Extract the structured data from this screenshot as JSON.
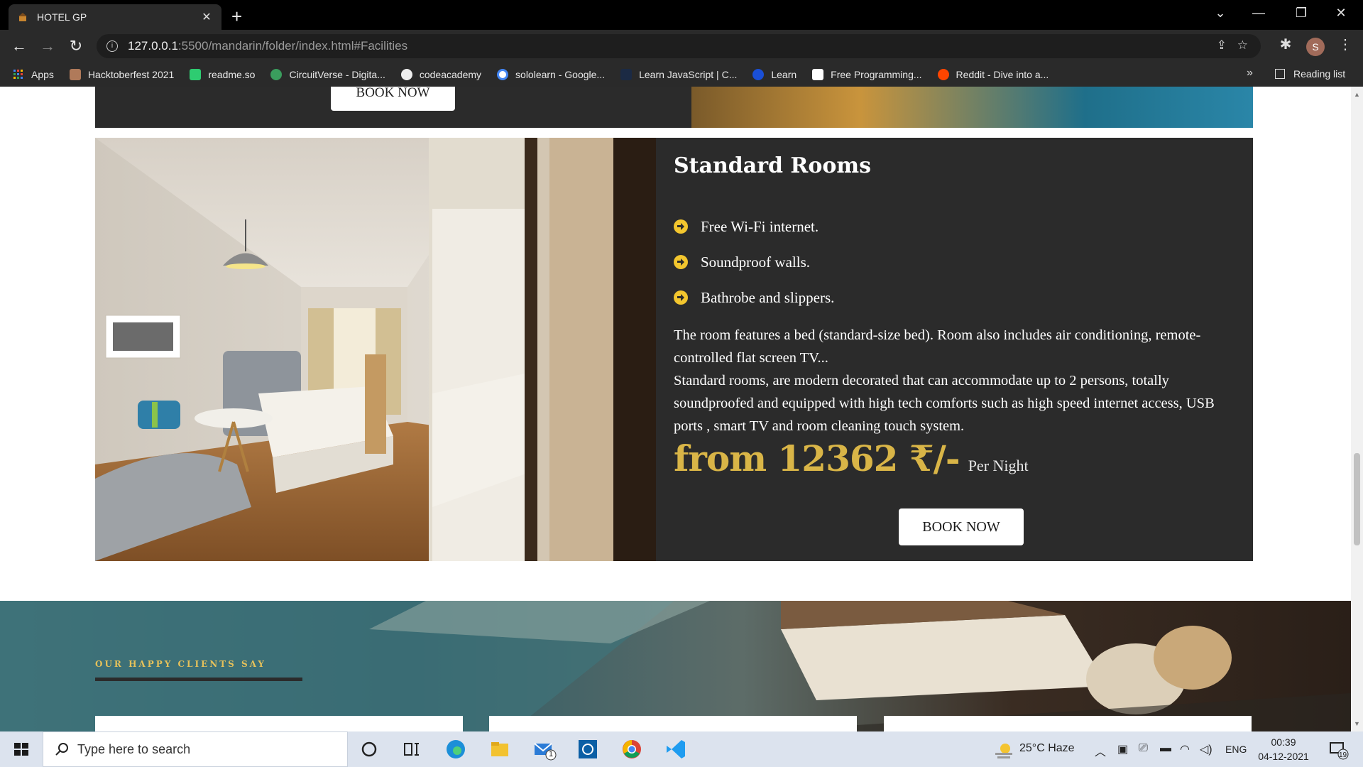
{
  "browser": {
    "tab_title": "HOTEL GP",
    "url_host": "127.0.0.1",
    "url_path": ":5500/mandarin/folder/index.html#Facilities",
    "profile_initial": "S"
  },
  "bookmarks": {
    "items": [
      {
        "label": "Apps"
      },
      {
        "label": "Hacktoberfest 2021"
      },
      {
        "label": "readme.so"
      },
      {
        "label": "CircuitVerse - Digita..."
      },
      {
        "label": "codeacademy"
      },
      {
        "label": "sololearn - Google..."
      },
      {
        "label": "Learn JavaScript | C..."
      },
      {
        "label": "Learn"
      },
      {
        "label": "Free Programming..."
      },
      {
        "label": "Reddit - Dive into a..."
      }
    ],
    "more": "»",
    "reading_list": "Reading list"
  },
  "page": {
    "prev_card": {
      "book_label": "BOOK NOW"
    },
    "room": {
      "title": "Standard Rooms",
      "features": [
        "Free Wi-Fi internet.",
        "Soundproof walls.",
        "Bathrobe and slippers."
      ],
      "description_1": "The room features a bed (standard-size bed). Room also includes air conditioning, remote-controlled flat screen TV...",
      "description_2": "Standard rooms, are modern decorated that can accommodate up to 2 persons, totally soundproofed and equipped with high tech comforts such as high speed internet access, USB ports , smart TV and room cleaning touch system.",
      "price": "from 12362 ₹/-",
      "price_unit": "Per Night",
      "book_label": "BOOK NOW"
    },
    "testimonials": {
      "eyebrow": "OUR HAPPY CLIENTS SAY"
    }
  },
  "taskbar": {
    "search_placeholder": "Type here to search",
    "mail_badge": "1",
    "weather": "25°C  Haze",
    "language": "ENG",
    "time": "00:39",
    "date": "04-12-2021",
    "notification_count": "19"
  },
  "colors": {
    "accent_gold": "#d9b547",
    "card_bg": "#2b2b2b",
    "bullet_yellow": "#f3c62e"
  }
}
